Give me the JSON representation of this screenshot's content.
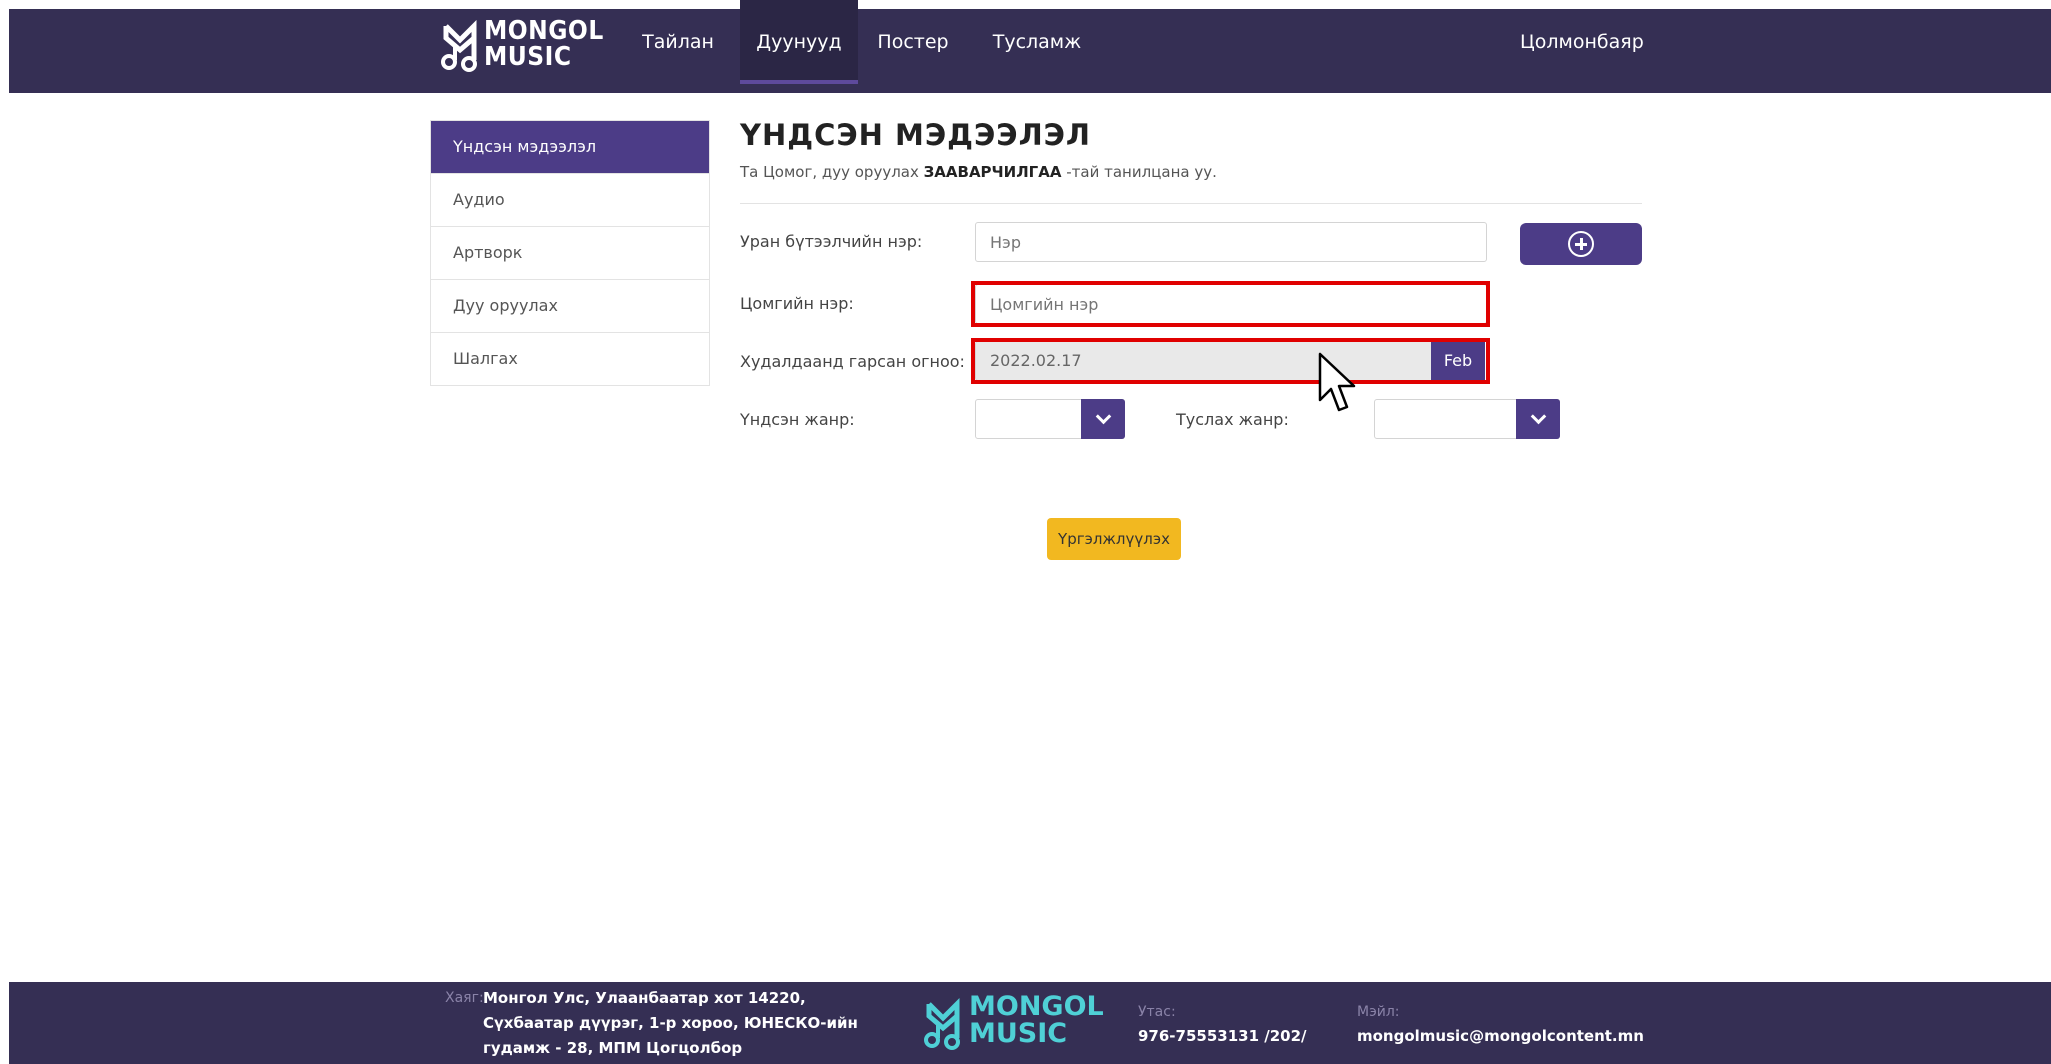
{
  "brand": {
    "line1": "MONGOL",
    "line2": "MUSIC"
  },
  "nav": {
    "items": [
      {
        "label": "Тайлан"
      },
      {
        "label": "Дуунууд"
      },
      {
        "label": "Постер"
      },
      {
        "label": "Тусламж"
      }
    ],
    "active": "Дуунууд",
    "user": "Цолмонбаяр"
  },
  "sidebar": {
    "items": [
      {
        "label": "Үндсэн мэдээлэл"
      },
      {
        "label": "Аудио"
      },
      {
        "label": "Артворк"
      },
      {
        "label": "Дуу оруулах"
      },
      {
        "label": "Шалгах"
      }
    ],
    "active": "Үндсэн мэдээлэл"
  },
  "main": {
    "title": "ҮНДСЭН МЭДЭЭЛЭЛ",
    "subtitle_pre": "Та Цомог, дуу оруулах ",
    "subtitle_bold": "ЗААВАРЧИЛГАА",
    "subtitle_post": " -тай танилцана уу.",
    "artist_label": "Уран бүтээлчийн нэр:",
    "artist_placeholder": "Нэр",
    "album_label": "Цомгийн нэр:",
    "album_placeholder": "Цомгийн нэр",
    "release_label": "Худалдаанд гарсан огноо:",
    "release_value": "2022.02.17",
    "release_month_btn": "Feb",
    "main_genre_label": "Үндсэн жанр:",
    "sub_genre_label": "Туслах жанр:",
    "continue_label": "Үргэлжлүүлэх"
  },
  "footer": {
    "address_label": "Хаяг:",
    "address_lines": [
      "Монгол Улс, Улаанбаатар хот 14220,",
      "Сүхбаатар дүүрэг, 1-р хороо, ЮНЕСКО-ийн",
      "гудамж - 28, МПМ Цогцолбор"
    ],
    "phone_label": "Утас:",
    "phone": "976-75553131 /202/",
    "email_label": "Мэйл:",
    "email": "mongolmusic@mongolcontent.mn"
  },
  "colors": {
    "nav_bg": "#352f54",
    "accent": "#4c3c87",
    "continue": "#f2b820",
    "highlight": "#e00000"
  }
}
